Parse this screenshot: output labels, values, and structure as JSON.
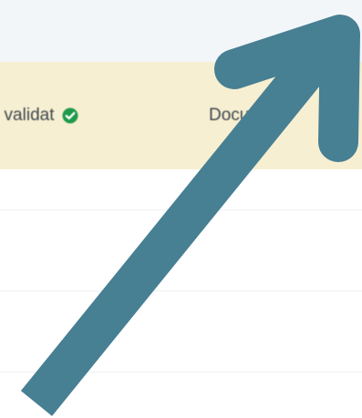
{
  "table": {
    "columns": [
      {
        "label": "t validat",
        "status_icon": "check-circle-icon",
        "status_color": "#1e9a4a"
      },
      {
        "label": "Document"
      }
    ],
    "header_background": "#f7efd1",
    "rows": [
      {
        "cells": [
          "",
          ""
        ]
      },
      {
        "cells": [
          "",
          ""
        ]
      },
      {
        "cells": [
          "",
          ""
        ]
      }
    ]
  },
  "overlay": {
    "icon": "arrow-up-right-icon",
    "color": "#477f93"
  }
}
